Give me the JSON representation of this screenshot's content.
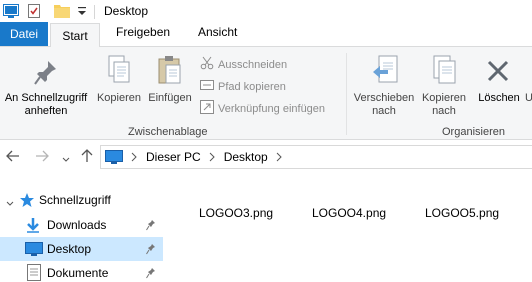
{
  "window": {
    "title": "Desktop"
  },
  "tabs": {
    "file": "Datei",
    "start": "Start",
    "share": "Freigeben",
    "view": "Ansicht"
  },
  "ribbon": {
    "pin": {
      "line1": "An Schnellzugriff",
      "line2": "anheften"
    },
    "copy": "Kopieren",
    "paste": "Einfügen",
    "cut": "Ausschneiden",
    "copy_path": "Pfad kopieren",
    "paste_shortcut": "Verknüpfung einfügen",
    "clipboard_group": "Zwischenablage",
    "move_to": {
      "line1": "Verschieben",
      "line2": "nach"
    },
    "copy_to": {
      "line1": "Kopieren",
      "line2": "nach"
    },
    "delete": "Löschen",
    "organize_group": "Organisieren",
    "rename_partial": "U"
  },
  "address": {
    "segments": [
      "Dieser PC",
      "Desktop"
    ]
  },
  "sidebar": {
    "items": [
      {
        "label": "Schnellzugriff"
      },
      {
        "label": "Downloads"
      },
      {
        "label": "Desktop"
      },
      {
        "label": "Dokumente"
      }
    ]
  },
  "files": [
    "LOGOO3.png",
    "LOGOO4.png",
    "LOGOO5.png"
  ],
  "colors": {
    "accent": "#1979ca",
    "selection": "#cce8ff",
    "folder": "#f7cf5b"
  }
}
